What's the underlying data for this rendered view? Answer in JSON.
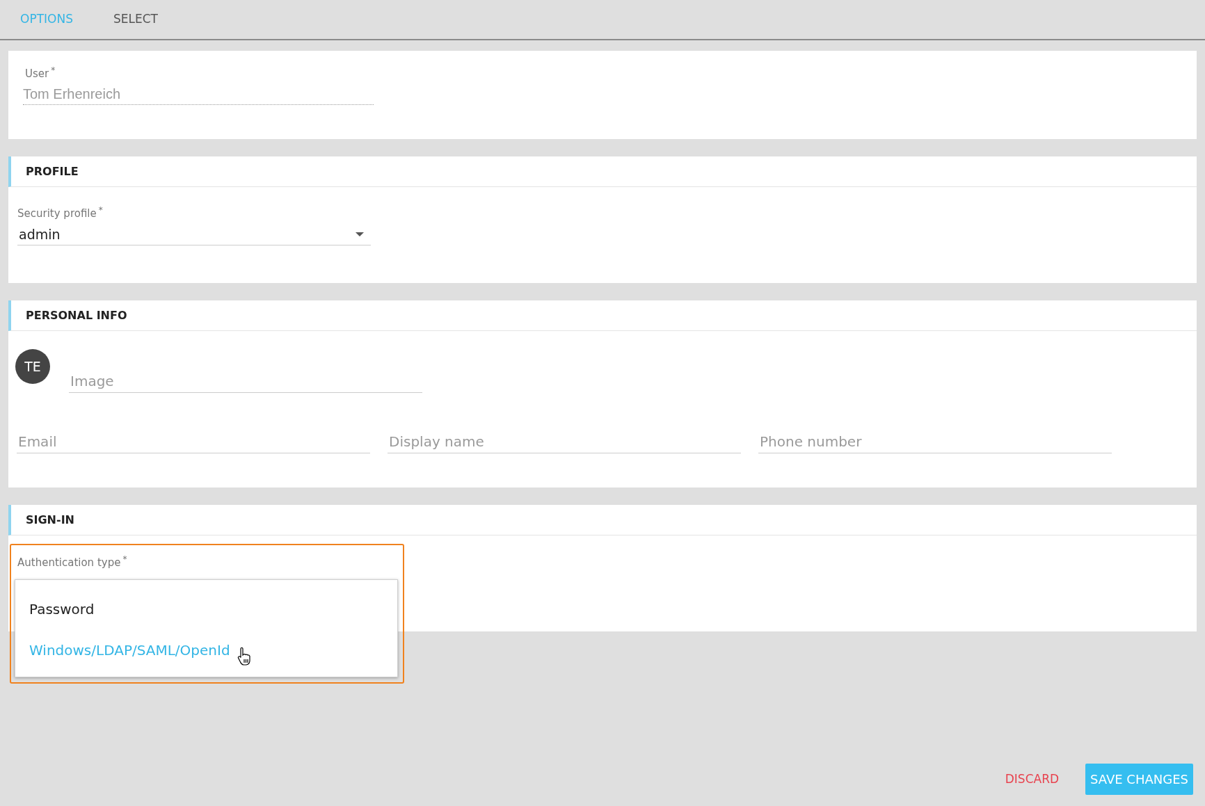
{
  "tabs": [
    {
      "label": "OPTIONS",
      "selected": true
    },
    {
      "label": "SELECT",
      "selected": false
    }
  ],
  "user_field": {
    "label": "User",
    "required_mark": "*",
    "value": "Tom Erhenreich",
    "disabled": true
  },
  "profile": {
    "title": "PROFILE",
    "field": {
      "label": "Security profile",
      "required_mark": "*",
      "value": "admin"
    }
  },
  "personal_info": {
    "title": "PERSONAL INFO",
    "avatar": {
      "initials": "TE"
    },
    "image_field": {
      "placeholder": "Image"
    },
    "fields": [
      {
        "placeholder": "Email"
      },
      {
        "placeholder": "Display name"
      },
      {
        "placeholder": "Phone number"
      }
    ]
  },
  "sign_in": {
    "title": "SIGN-IN",
    "field": {
      "label": "Authentication type",
      "required_mark": "*",
      "focused": true,
      "options": [
        {
          "label": "Password",
          "selected": false
        },
        {
          "label": "Windows/LDAP/SAML/OpenId",
          "selected": true
        }
      ]
    }
  },
  "buttons": {
    "discard": "DISCARD",
    "save": "SAVE CHANGES"
  }
}
